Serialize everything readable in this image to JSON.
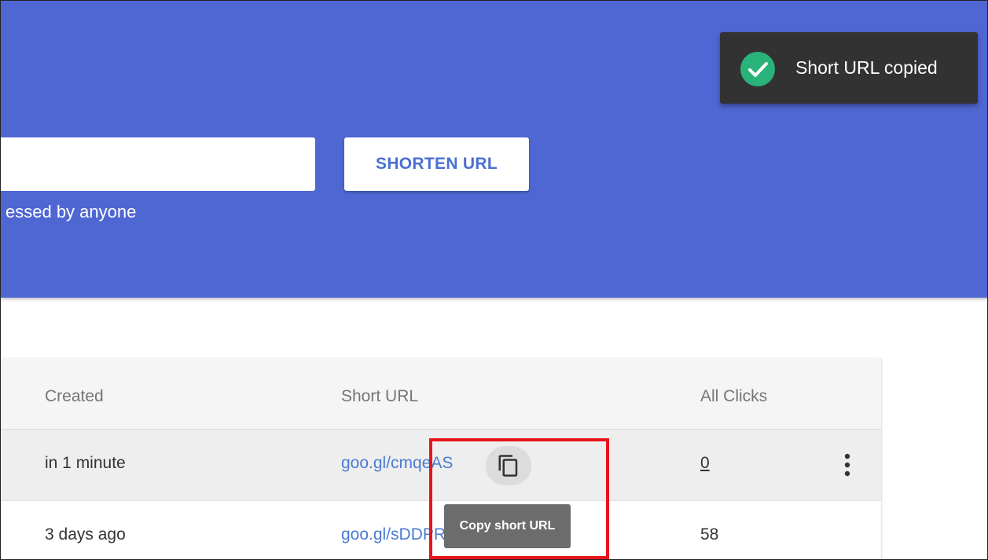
{
  "header": {
    "input_placeholder": "",
    "shorten_button": "SHORTEN URL",
    "hint_text": "essed by anyone"
  },
  "snackbar": {
    "icon": "check-circle-icon",
    "message": "Short URL copied",
    "accent": "#2ab27b"
  },
  "table": {
    "columns": [
      "Created",
      "Short URL",
      "All Clicks"
    ],
    "rows": [
      {
        "created": "in 1 minute",
        "short_url": "goo.gl/cmqeAS",
        "clicks": "0"
      },
      {
        "created": "3 days ago",
        "short_url": "goo.gl/sDDPR",
        "clicks": "58"
      }
    ]
  },
  "tooltip": {
    "text": "Copy short URL"
  },
  "colors": {
    "hero_bg": "#4f67d3",
    "link": "#4a7bd2",
    "highlight": "#e8141b"
  }
}
